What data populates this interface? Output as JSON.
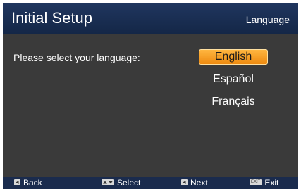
{
  "header": {
    "title": "Initial Setup",
    "section": "Language"
  },
  "main": {
    "prompt": "Please select your language:",
    "languages": [
      {
        "label": "English",
        "selected": true
      },
      {
        "label": "Español",
        "selected": false
      },
      {
        "label": "Français",
        "selected": false
      }
    ]
  },
  "footer": {
    "back_label": "Back",
    "select_label": "Select",
    "next_label": "Next",
    "exit_key_label": "EXIT",
    "exit_label": "Exit"
  },
  "colors": {
    "header_bg": "#1a2f55",
    "body_bg": "#3a3a3a",
    "selected_bg": "#f5a020",
    "footer_bg": "#1a2b4d"
  },
  "icons": {
    "back": "left-arrow-key-icon",
    "select": "up-down-arrow-keys-icon",
    "next": "left-arrow-key-icon",
    "exit": "exit-key-icon"
  }
}
